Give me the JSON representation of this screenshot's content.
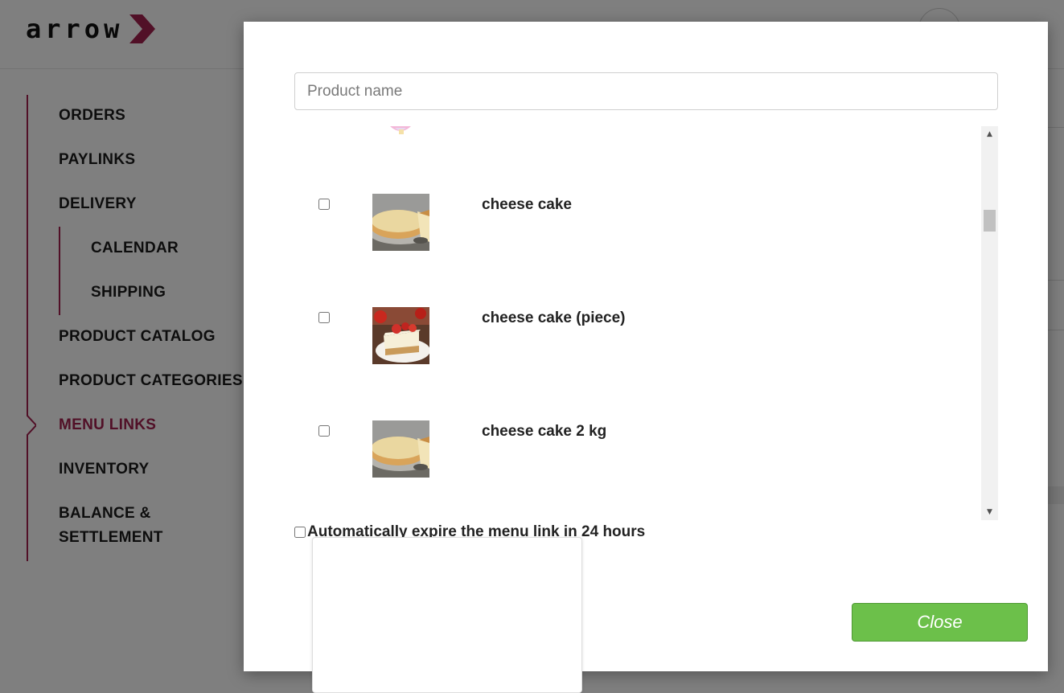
{
  "brand": {
    "logo_text": "arrow",
    "accent_color": "#a3214f"
  },
  "sidebar": {
    "items": [
      {
        "label": "ORDERS"
      },
      {
        "label": "PAYLINKS"
      },
      {
        "label": "DELIVERY"
      },
      {
        "label": "CALENDAR"
      },
      {
        "label": "SHIPPING"
      },
      {
        "label": "PRODUCT CATALOG"
      },
      {
        "label": "PRODUCT CATEGORIES"
      },
      {
        "label": "MENU LINKS",
        "active": true
      },
      {
        "label": "INVENTORY"
      },
      {
        "label": "BALANCE &"
      },
      {
        "label": "SETTLEMENT"
      }
    ]
  },
  "modal": {
    "search": {
      "placeholder": "Product name",
      "value": ""
    },
    "products": [
      {
        "name": "cheese cake",
        "checked": false,
        "image": "cheesecake-whole"
      },
      {
        "name": "cheese cake (piece)",
        "checked": false,
        "image": "cheesecake-slice-strawberry"
      },
      {
        "name": "cheese cake 2 kg",
        "checked": false,
        "image": "cheesecake-whole"
      }
    ],
    "expire_label": "Automatically expire the menu link in 24 hours",
    "expire_checked": false,
    "close_label": "Close",
    "close_color": "#6cc04a"
  },
  "icons": {
    "scroll_up": "scroll-up-arrow-icon",
    "scroll_down": "scroll-down-arrow-icon",
    "logo_chevron": "chevron-right-icon"
  }
}
